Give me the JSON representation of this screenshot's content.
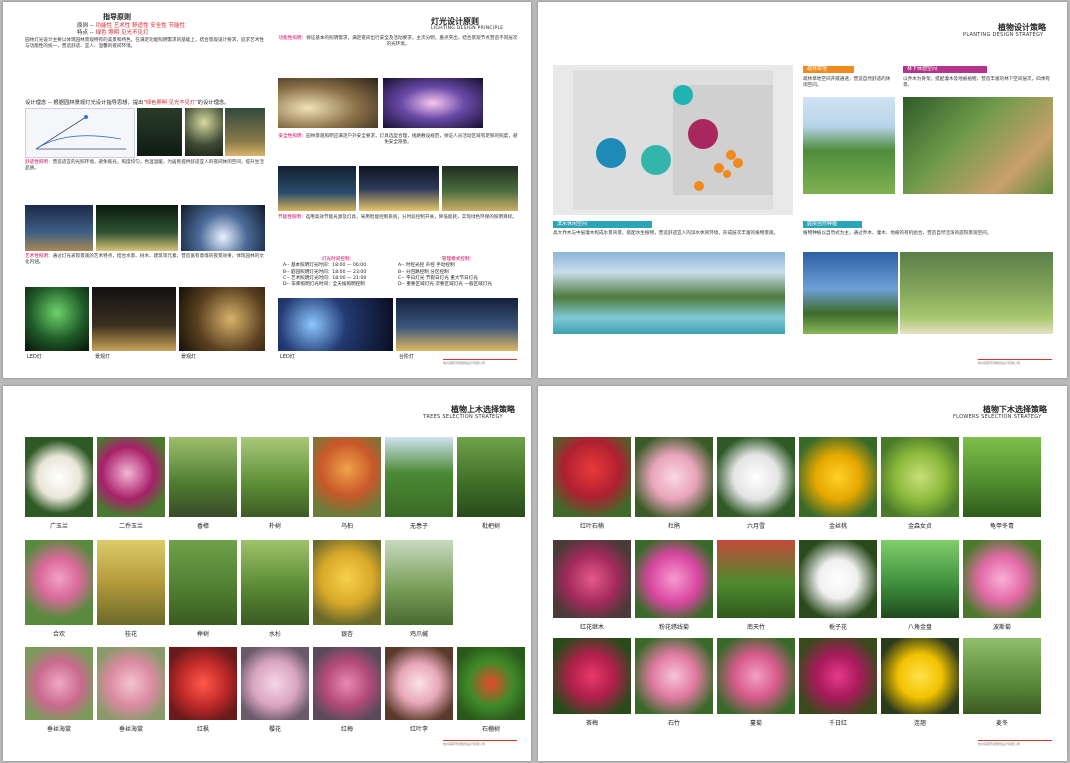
{
  "page1": {
    "title": "指导原则",
    "principle_label": "原则 --",
    "principle_value": "功能性 艺术性 舒适性 安全性 节能性",
    "features_label": "特点 --",
    "features_value": "绿色 照明 见光不见灯",
    "intro": "园林灯光设计主要以体现园林景观特有的美景和特色，在满足功能照明需求的基础上，结合景观设计要求，追求艺术性与功能性的统一，营造舒适、宜人、温馨的夜间环境。",
    "concept_prefix": "设计理念 -- 根据园林景观灯光设计指导思想，提出",
    "concept_highlight": "\"绿色照明 见光不见灯\"",
    "concept_suffix": "的设计理念。",
    "right_title": "灯光设计原则",
    "right_title_en": "LIGHTING DESIGN PRINCIPLE",
    "func_title": "功能性照明：",
    "func_text": "保证基本的照明需求，满足夜间出行安全及活动要求，主次分明，重点突出，结合景观节点营造不同层次的光环境。",
    "art_title": "艺术性照明：",
    "art_text": "通过灯光表现景观的艺术特点，结合水景、树木、建筑等元素，营造富有意境的夜景效果，体现园林的文化内涵。",
    "comfort_title": "舒适性照明：",
    "comfort_text": "营造适宜的光照环境，避免眩光，照度均匀，色温温暖，为居民提供舒适宜人的夜间休闲空间，提升生活品质。",
    "safety_title": "安全性照明：",
    "safety_text": "园林景观照明应满足户外安全要求，灯具选型合理，线路敷设规范，保证人员活动区域有足够的照度，避免安全隐患。",
    "energy_title": "节能性照明：",
    "energy_text": "选用高效节能光源及灯具，采用智能控制系统，分时段控制开关，降低能耗，实现绿色环保的照明目标。",
    "schedule_title": "灯光时间控制：",
    "schedule_items": [
      "A-- 基本照明灯光时间：18:00 — 06:00",
      "B-- 庭园照明灯光时间：18:00 — 23:00",
      "C-- 艺术照明灯光时间：18:00 — 21:00",
      "D-- 车库照明灯光时间：全天候照明控制"
    ],
    "mode_title": "管理模式控制：",
    "mode_items": [
      "A-- 时控光控 声控 手动控制",
      "B-- 分回路控制 分区控制",
      "C-- 平日灯光 节假日灯光 重大节日灯光",
      "D-- 重要区域灯光 次要区域灯光 一般区域灯光"
    ],
    "cap_left": [
      "LED灯",
      "景观灯",
      "景观灯"
    ],
    "cap_right": [
      "LED灯",
      "台阶灯"
    ],
    "footer": "杭州润邦景观规划设计有限公司"
  },
  "page2": {
    "title": "植物设计策略",
    "title_en": "PLANTING DESIGN STRATEGY",
    "bar1": "疏林草地",
    "text1": "疏林草地空间开敞通透，营造自然舒适的休闲空间。",
    "bar2": "林下休憩空间",
    "text2": "以乔木为骨架，搭配灌木及地被植物，营造丰富的林下空间层次，四季有景。",
    "bar3": "滨水休闲空间",
    "text3": "高大乔木与中层灌木构成水景背景，搭配水生植物，营造舒适宜人的滨水休闲环境，形成层次丰富的植物景观。",
    "bar4": "庭院自然种植",
    "text4": "植物种植以自然式为主，通过乔木、灌木、地被的有机组合，营造自然活泼的庭院景观空间。",
    "footer": "杭州润邦景观规划设计有限公司"
  },
  "page3": {
    "title": "植物上木选择策略",
    "title_en": "TREES SELECTION STRATEGY",
    "trees": [
      "广玉兰",
      "二乔玉兰",
      "香樟",
      "朴树",
      "乌桕",
      "无患子",
      "枇杷树",
      "合欢",
      "桂花",
      "榉树",
      "水杉",
      "银杏",
      "鸡爪槭",
      "垂丝海棠",
      "垂丝海棠",
      "红枫",
      "樱花",
      "红梅",
      "红叶李",
      "石榴树"
    ],
    "footer": "杭州润邦景观规划设计有限公司"
  },
  "page4": {
    "title": "植物下木选择策略",
    "title_en": "FLOWERS SELECTION STRATEGY",
    "flowers": [
      "红叶石楠",
      "杜鹃",
      "六月雪",
      "金丝桃",
      "金森女贞",
      "龟甲冬青",
      "红花继木",
      "粉花绣线菊",
      "南天竹",
      "栀子花",
      "八角金盘",
      "波斯菊",
      "茶梅",
      "石竹",
      "蔓菊",
      "千日红",
      "连翘",
      "麦冬"
    ],
    "footer": "杭州润邦景观规划设计有限公司"
  },
  "colors": {
    "accent_red": "#d2232a",
    "accent_pink": "#d4005f",
    "bar_teal": "#2aa5b8",
    "bar_orange": "#f08a1c",
    "bar_magenta": "#b5338a"
  }
}
